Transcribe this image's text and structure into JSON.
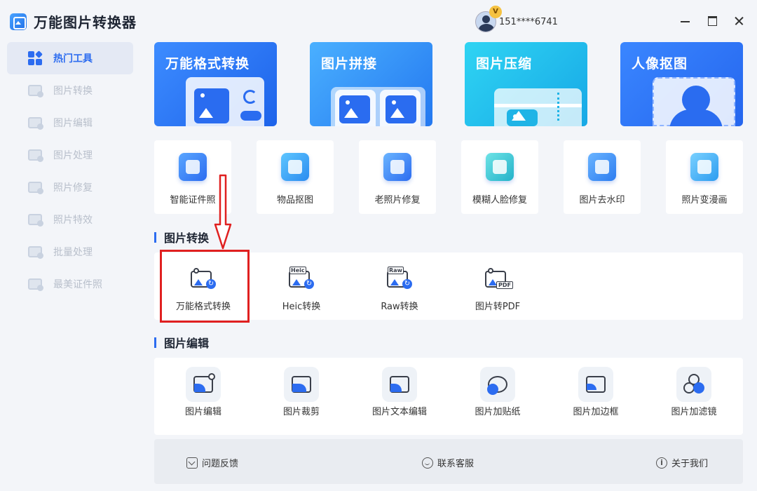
{
  "app": {
    "title": "万能图片转换器"
  },
  "sidebar": {
    "items": [
      {
        "label": "热门工具",
        "active": true
      },
      {
        "label": "图片转换"
      },
      {
        "label": "图片编辑"
      },
      {
        "label": "图片处理"
      },
      {
        "label": "照片修复"
      },
      {
        "label": "照片特效"
      },
      {
        "label": "批量处理"
      },
      {
        "label": "最美证件照"
      }
    ]
  },
  "user": {
    "badge": "V",
    "phone": "151****6741"
  },
  "hero_cards": [
    {
      "title": "万能格式转换"
    },
    {
      "title": "图片拼接"
    },
    {
      "title": "图片压缩"
    },
    {
      "title": "人像抠图"
    }
  ],
  "features": [
    {
      "label": "智能证件照"
    },
    {
      "label": "物品抠图"
    },
    {
      "label": "老照片修复"
    },
    {
      "label": "模糊人脸修复"
    },
    {
      "label": "图片去水印"
    },
    {
      "label": "照片变漫画"
    }
  ],
  "sections": {
    "convert": {
      "title": "图片转换",
      "tools": [
        {
          "label": "万能格式转换"
        },
        {
          "label": "Heic转换",
          "tag": "Heic"
        },
        {
          "label": "Raw转换",
          "tag": "Raw"
        },
        {
          "label": "图片转PDF",
          "tag": "PDF"
        }
      ]
    },
    "edit": {
      "title": "图片编辑",
      "tools": [
        {
          "label": "图片编辑"
        },
        {
          "label": "图片裁剪"
        },
        {
          "label": "图片文本编辑"
        },
        {
          "label": "图片加贴纸"
        },
        {
          "label": "图片加边框"
        },
        {
          "label": "图片加滤镜"
        }
      ]
    }
  },
  "footer": {
    "feedback": "问题反馈",
    "support": "联系客服",
    "about": "关于我们",
    "info_glyph": "i"
  },
  "colors": {
    "accent": "#2c6cf0",
    "highlight": "#e02020"
  }
}
